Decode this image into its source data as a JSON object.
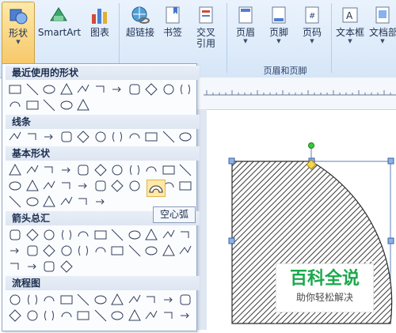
{
  "ribbon": {
    "buttons": [
      {
        "id": "shapes",
        "label": "形状"
      },
      {
        "id": "smartart",
        "label": "SmartArt"
      },
      {
        "id": "chart",
        "label": "图表"
      },
      {
        "id": "hyperlink",
        "label": "超链接"
      },
      {
        "id": "bookmark",
        "label": "书签"
      },
      {
        "id": "crossref",
        "label": "交叉\n引用"
      },
      {
        "id": "header",
        "label": "页眉"
      },
      {
        "id": "footer",
        "label": "页脚"
      },
      {
        "id": "pagenum",
        "label": "页码"
      },
      {
        "id": "textbox",
        "label": "文本框"
      },
      {
        "id": "docparts",
        "label": "文档部"
      }
    ],
    "group_label": "页眉和页脚"
  },
  "gallery": {
    "sections": [
      {
        "title": "最近使用的形状"
      },
      {
        "title": "线条"
      },
      {
        "title": "基本形状"
      },
      {
        "title": "箭头总汇"
      },
      {
        "title": "流程图"
      }
    ],
    "tooltip": "空心弧"
  },
  "watermark": {
    "title": "百科全说",
    "subtitle": "助你轻松解决"
  }
}
